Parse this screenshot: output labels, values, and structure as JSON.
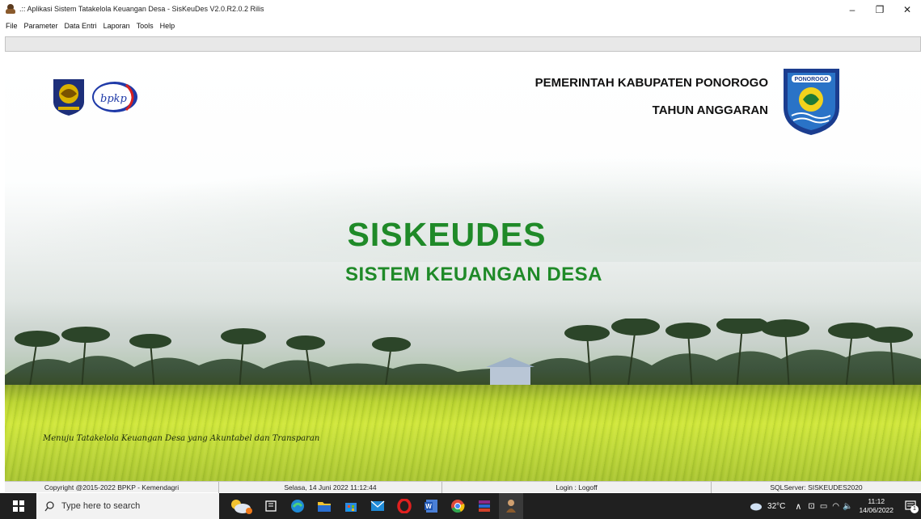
{
  "window": {
    "title": ".:: Aplikasi Sistem Tatakelola Keuangan Desa - SisKeuDes V2.0.R2.0.2 Rilis",
    "minimize": "–",
    "restore": "❐",
    "close": "✕"
  },
  "menu": [
    "File",
    "Parameter",
    "Data Entri",
    "Laporan",
    "Tools",
    "Help"
  ],
  "header": {
    "government": "PEMERINTAH KABUPATEN PONOROGO",
    "fiscal_year": "TAHUN ANGGARAN",
    "bpkp_logo_text": "bpkp",
    "ponorogo_logo_text": "PONOROGO"
  },
  "splash": {
    "title": "SISKEUDES",
    "subtitle": "SISTEM KEUANGAN DESA",
    "tagline": "Menuju Tatakelola Keuangan Desa yang Akuntabel dan Transparan"
  },
  "status": {
    "copyright": "Copyright @2015-2022 BPKP - Kemendagri",
    "datetime": "Selasa, 14 Juni 2022  11:12:44",
    "login": "Login : Logoff",
    "server": "SQLServer: SISKEUDES2020"
  },
  "taskbar": {
    "search_placeholder": "Type here to search",
    "temperature": "32°C",
    "time": "11:12",
    "date": "14/06/2022",
    "notification_count": "1"
  },
  "colors": {
    "accent_green": "#1f8a28",
    "taskbar_bg": "#202020"
  }
}
